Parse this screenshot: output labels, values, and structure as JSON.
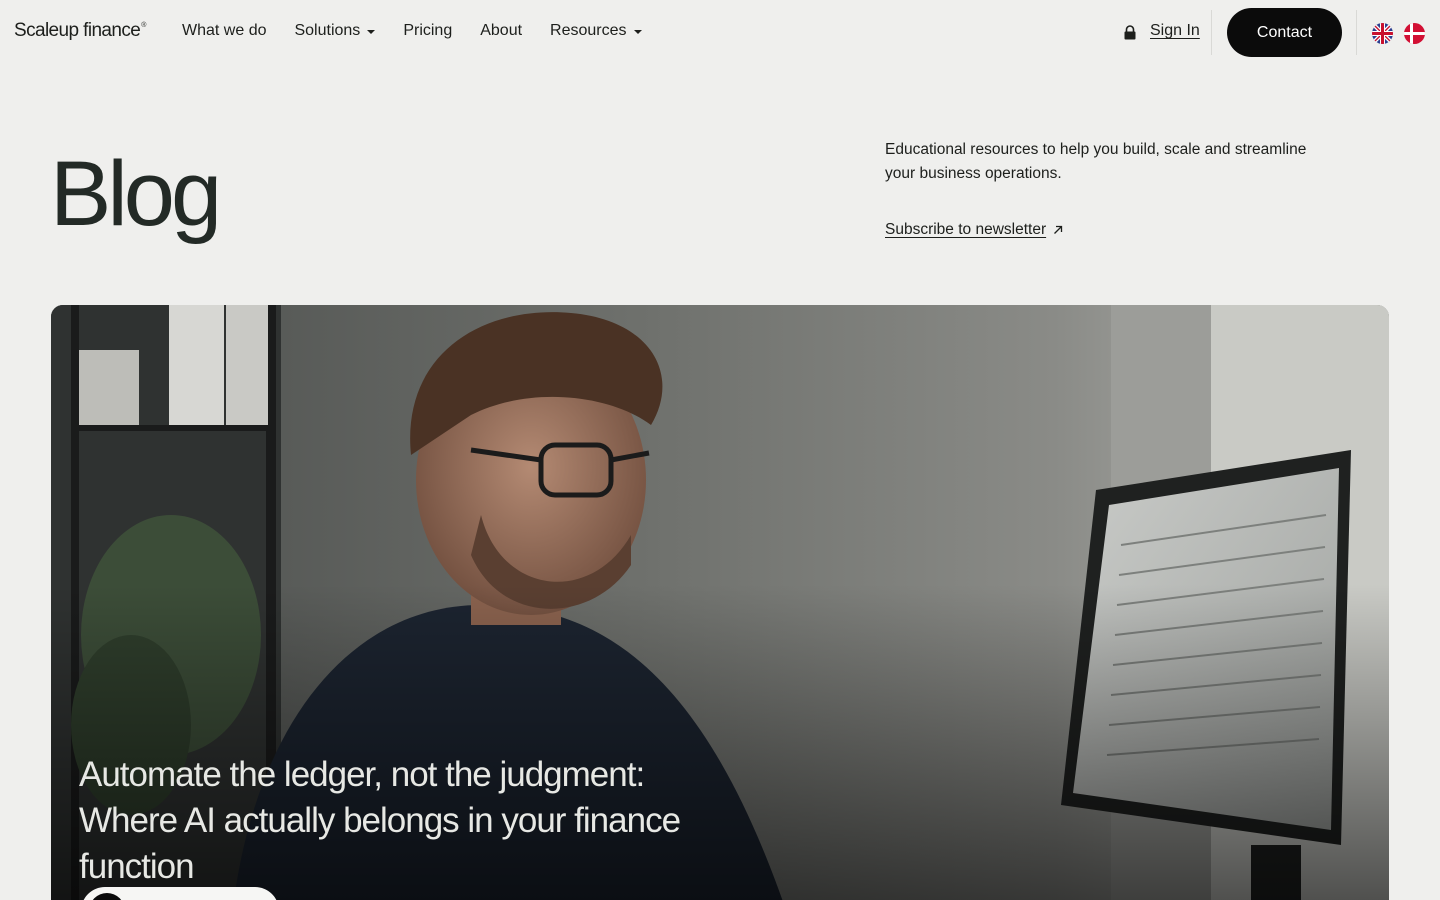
{
  "header": {
    "logo_text": "Scaleup finance",
    "logo_mark": "®",
    "nav": [
      {
        "label": "What we do",
        "dropdown": false
      },
      {
        "label": "Solutions",
        "dropdown": true
      },
      {
        "label": "Pricing",
        "dropdown": false
      },
      {
        "label": "About",
        "dropdown": false
      },
      {
        "label": "Resources",
        "dropdown": true
      }
    ],
    "sign_in_label": "Sign In",
    "contact_label": "Contact",
    "languages": [
      "uk-flag-icon",
      "denmark-flag-icon"
    ]
  },
  "hero": {
    "title": "Blog",
    "intro": "Educational resources to help you build, scale and streamline your business operations.",
    "newsletter_label": "Subscribe to newsletter"
  },
  "featured_post": {
    "title": "Automate the ledger, not the judgment: Where AI actually belongs in your finance function"
  },
  "colors": {
    "background": "#efefed",
    "text": "#1d1f1c",
    "button": "#0b0b0b",
    "button_text": "#ffffff"
  }
}
